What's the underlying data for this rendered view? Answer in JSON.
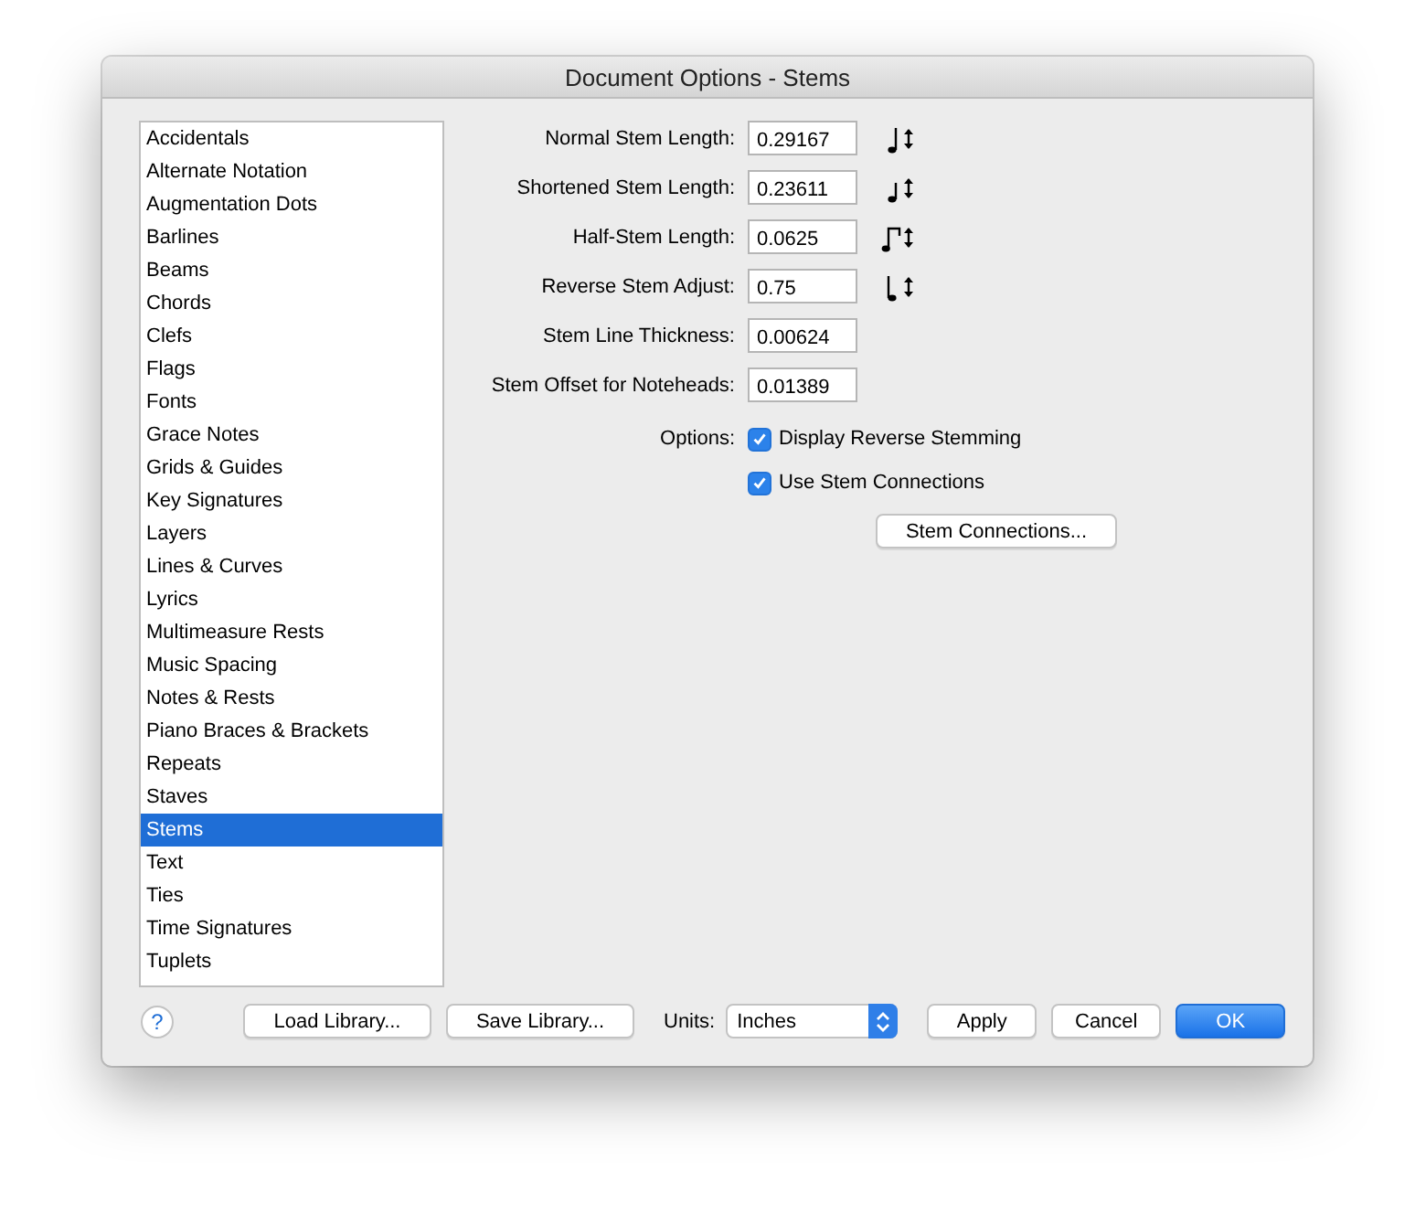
{
  "window": {
    "title": "Document Options - Stems"
  },
  "sidebar": {
    "items": [
      {
        "label": "Accidentals",
        "selected": false
      },
      {
        "label": "Alternate Notation",
        "selected": false
      },
      {
        "label": "Augmentation Dots",
        "selected": false
      },
      {
        "label": "Barlines",
        "selected": false
      },
      {
        "label": "Beams",
        "selected": false
      },
      {
        "label": "Chords",
        "selected": false
      },
      {
        "label": "Clefs",
        "selected": false
      },
      {
        "label": "Flags",
        "selected": false
      },
      {
        "label": "Fonts",
        "selected": false
      },
      {
        "label": "Grace Notes",
        "selected": false
      },
      {
        "label": "Grids & Guides",
        "selected": false
      },
      {
        "label": "Key Signatures",
        "selected": false
      },
      {
        "label": "Layers",
        "selected": false
      },
      {
        "label": "Lines & Curves",
        "selected": false
      },
      {
        "label": "Lyrics",
        "selected": false
      },
      {
        "label": "Multimeasure Rests",
        "selected": false
      },
      {
        "label": "Music Spacing",
        "selected": false
      },
      {
        "label": "Notes & Rests",
        "selected": false
      },
      {
        "label": "Piano Braces & Brackets",
        "selected": false
      },
      {
        "label": "Repeats",
        "selected": false
      },
      {
        "label": "Staves",
        "selected": false
      },
      {
        "label": "Stems",
        "selected": true
      },
      {
        "label": "Text",
        "selected": false
      },
      {
        "label": "Ties",
        "selected": false
      },
      {
        "label": "Time Signatures",
        "selected": false
      },
      {
        "label": "Tuplets",
        "selected": false
      }
    ]
  },
  "fields": [
    {
      "label": "Normal Stem Length:",
      "value": "0.29167",
      "kind": "stem-up"
    },
    {
      "label": "Shortened Stem Length:",
      "value": "0.23611",
      "kind": "stem-up-short"
    },
    {
      "label": "Half-Stem Length:",
      "value": "0.0625",
      "kind": "half-stem"
    },
    {
      "label": "Reverse Stem Adjust:",
      "value": "0.75",
      "kind": "stem-down"
    },
    {
      "label": "Stem Line Thickness:",
      "value": "0.00624",
      "kind": "plain"
    },
    {
      "label": "Stem Offset for Noteheads:",
      "value": "0.01389",
      "kind": "plain"
    }
  ],
  "options": {
    "label": "Options:",
    "checkboxes": [
      {
        "label": "Display Reverse Stemming",
        "checked": true
      },
      {
        "label": "Use Stem Connections",
        "checked": true
      }
    ],
    "button": "Stem Connections..."
  },
  "footer": {
    "help": "?",
    "left_buttons": [
      "Load Library...",
      "Save Library..."
    ],
    "units": {
      "label": "Units:",
      "value": "Inches"
    },
    "buttons": [
      {
        "label": "Apply",
        "default": false
      },
      {
        "label": "Cancel",
        "default": false
      },
      {
        "label": "OK",
        "default": true
      }
    ]
  }
}
